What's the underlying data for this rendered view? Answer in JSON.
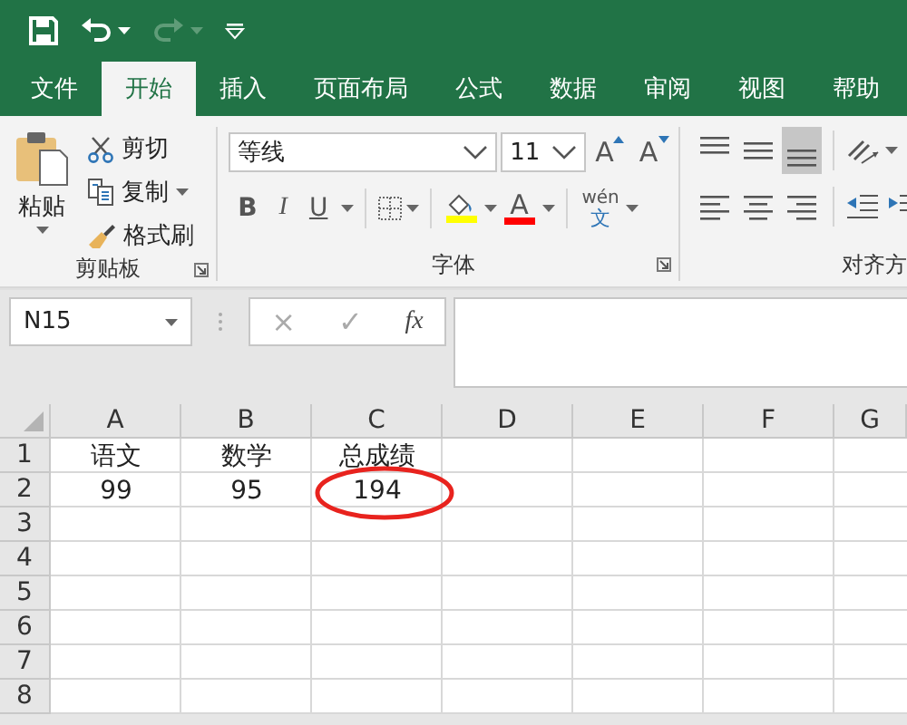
{
  "quick_access": [
    {
      "kind": "save"
    },
    {
      "kind": "undo"
    },
    {
      "kind": "redo"
    },
    {
      "kind": "customize"
    }
  ],
  "tabs": [
    {
      "label": "文件",
      "selected": false
    },
    {
      "label": "开始",
      "selected": true
    },
    {
      "label": "插入",
      "selected": false
    },
    {
      "label": "页面布局",
      "selected": false
    },
    {
      "label": "公式",
      "selected": false
    },
    {
      "label": "数据",
      "selected": false
    },
    {
      "label": "审阅",
      "selected": false
    },
    {
      "label": "视图",
      "selected": false
    },
    {
      "label": "帮助",
      "selected": false
    }
  ],
  "ribbon": {
    "clipboard": {
      "label": "剪贴板",
      "paste": "粘贴",
      "items": [
        {
          "kind": "cut",
          "label": "剪切"
        },
        {
          "kind": "copy",
          "label": "复制"
        },
        {
          "kind": "painter",
          "label": "格式刷"
        }
      ]
    },
    "font": {
      "label": "字体",
      "font_name": "等线",
      "font_size": "11",
      "grow": "A",
      "shrink": "A",
      "bold": "B",
      "italic": "I",
      "underline": "U",
      "font_color_letter": "A",
      "phonetic_top": "wén",
      "phonetic_bottom": "文"
    },
    "alignment": {
      "label": "对齐方",
      "vertical": [
        {
          "kind": "top",
          "selected": false
        },
        {
          "kind": "middle",
          "selected": false
        },
        {
          "kind": "bottom",
          "selected": true
        }
      ],
      "horizontal": [
        {
          "kind": "left",
          "selected": false
        },
        {
          "kind": "center",
          "selected": false
        },
        {
          "kind": "right",
          "selected": false
        }
      ]
    }
  },
  "formula_bar": {
    "name_box": "N15",
    "cancel": "×",
    "enter": "✓",
    "function": "fx"
  },
  "sheet": {
    "columns": [
      "A",
      "B",
      "C",
      "D",
      "E",
      "F",
      "G"
    ],
    "rows": [
      {
        "number": "1",
        "cells": {
          "A": {
            "value": "语文",
            "circled": false
          },
          "B": {
            "value": "数学",
            "circled": false
          },
          "C": {
            "value": "总成绩",
            "circled": false
          }
        }
      },
      {
        "number": "2",
        "cells": {
          "A": {
            "value": "99",
            "circled": false
          },
          "B": {
            "value": "95",
            "circled": false
          },
          "C": {
            "value": "194",
            "circled": true
          }
        }
      },
      {
        "number": "3",
        "cells": {}
      },
      {
        "number": "4",
        "cells": {}
      },
      {
        "number": "5",
        "cells": {}
      },
      {
        "number": "6",
        "cells": {}
      },
      {
        "number": "7",
        "cells": {}
      },
      {
        "number": "8",
        "cells": {}
      }
    ]
  }
}
